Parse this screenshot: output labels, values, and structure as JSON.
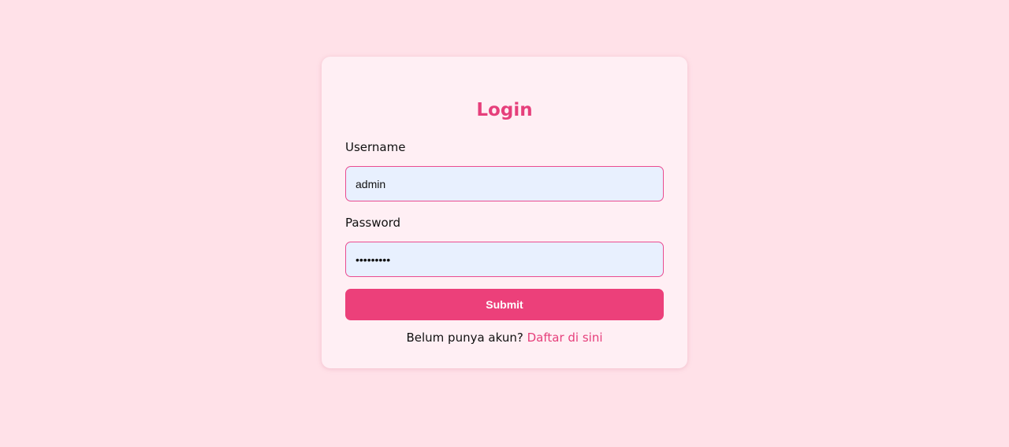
{
  "login_form": {
    "title": "Login",
    "username": {
      "label": "Username",
      "value": "admin"
    },
    "password": {
      "label": "Password",
      "value": "•••••••••"
    },
    "submit_label": "Submit",
    "register_prompt": "Belum punya akun?",
    "register_link": "Daftar di sini"
  },
  "colors": {
    "page_background": "#ffe1e8",
    "card_background": "#ffeff4",
    "accent": "#ec407a",
    "input_fill": "#e8f0fe",
    "input_border": "#ea4b90"
  }
}
